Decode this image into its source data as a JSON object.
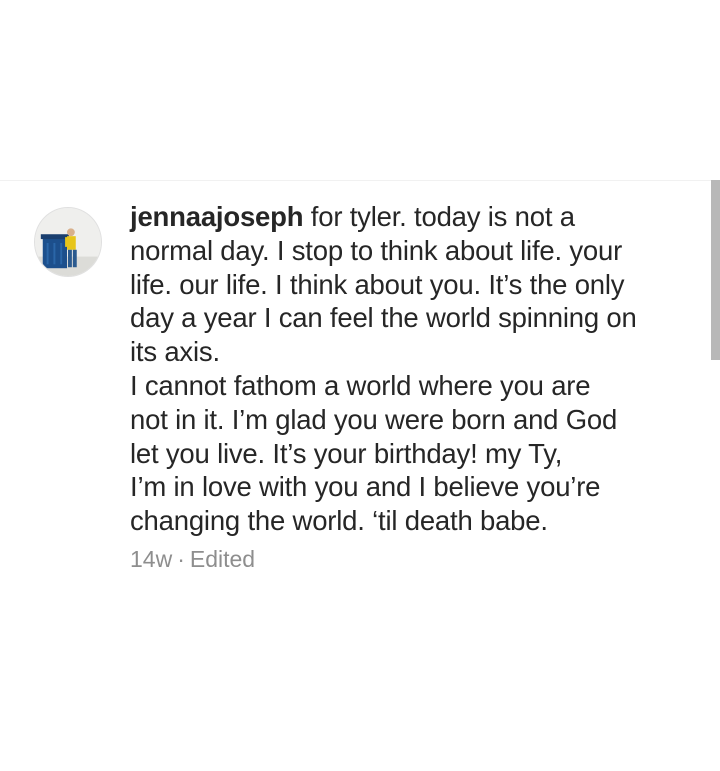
{
  "comment": {
    "username": "jennaajoseph",
    "lines": [
      " for tyler. today is not a",
      "normal day. I stop to think about life. your",
      "life. our life. I think about you. It’s the only",
      "day a year I can feel the world spinning on",
      "its axis.",
      "I cannot fathom a world where you are",
      "not in it. I’m glad you were born and God",
      "let you live. It’s your birthday! my Ty,",
      "I’m in love with you and I believe you’re",
      "changing the world. ‘til death babe."
    ],
    "time_ago": "14w",
    "separator": "·",
    "edited_label": "Edited"
  },
  "colors": {
    "text": "#262626",
    "meta": "#8e8e8e",
    "scrollbar": "#b8b8b8",
    "background": "#ffffff"
  },
  "icons": {
    "avatar": "profile-photo-avatar"
  }
}
